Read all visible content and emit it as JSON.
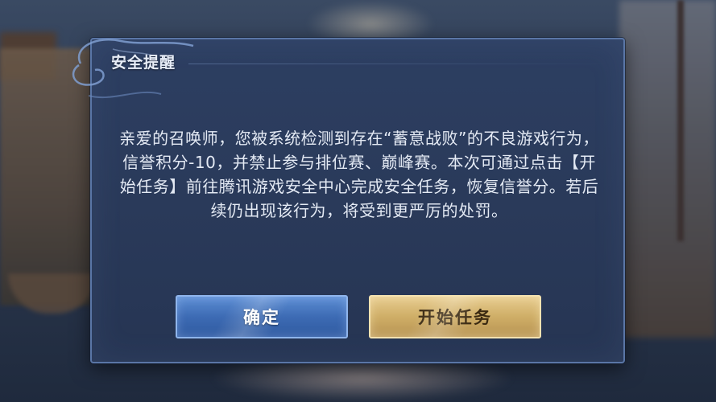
{
  "dialog": {
    "title": "安全提醒",
    "message": "亲爱的召唤师，您被系统检测到存在“蓄意战败”的不良游戏行为，信誉积分-10，并禁止参与排位赛、巅峰赛。本次可通过点击【开始任务】前往腾讯游戏安全中心完成安全任务，恢复信誉分。若后续仍出现该行为，将受到更严厉的处罚。",
    "buttons": {
      "confirm_label": "确定",
      "start_task_label": "开始任务"
    }
  },
  "colors": {
    "dialog_bg": "#2a3a5a",
    "dialog_border": "#5a76a6",
    "confirm_button": "#3d6bb4",
    "start_task_button": "#cfae67"
  },
  "icons": {
    "title_decoration": "swirl-ornament-icon"
  }
}
